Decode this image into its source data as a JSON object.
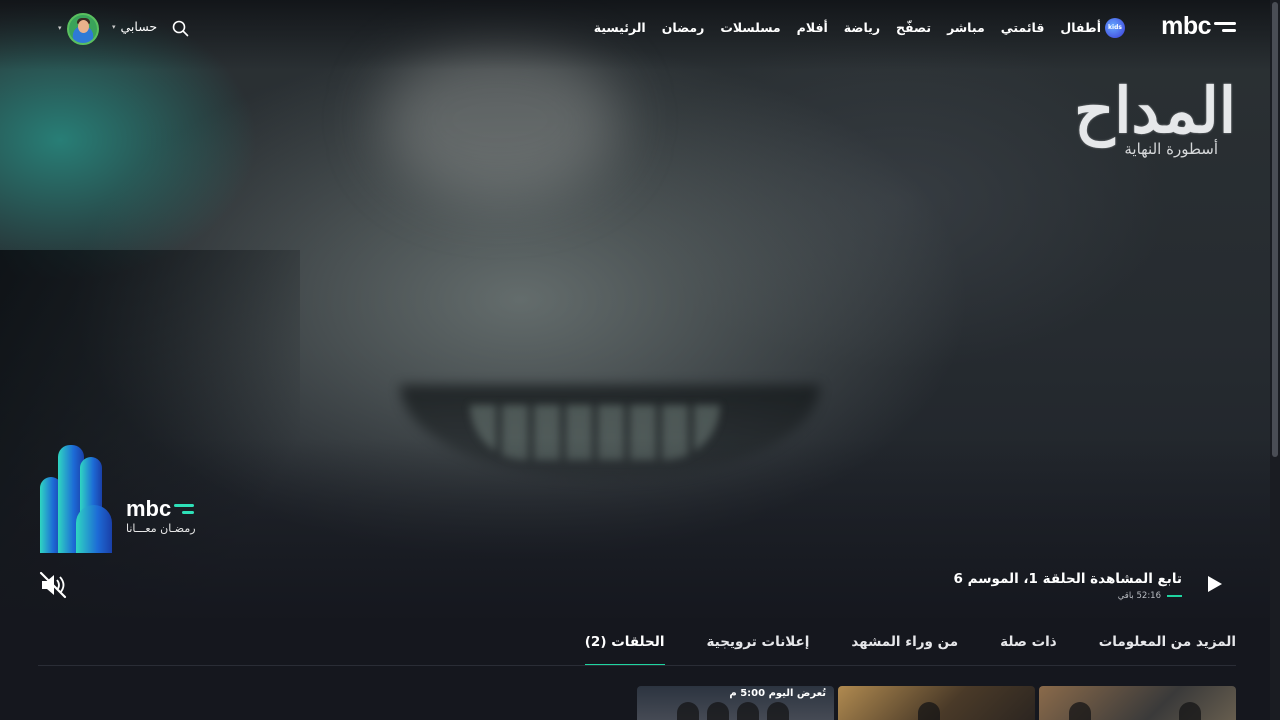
{
  "nav": {
    "logo": "mbc",
    "items": [
      "الرئيسية",
      "رمضان",
      "مسلسلات",
      "أفلام",
      "رياضة",
      "تصفّح",
      "مباشر",
      "قائمتي"
    ],
    "kids_label": "أطفال",
    "kids_badge": "kids",
    "account_label": "حسابي"
  },
  "show": {
    "title": "المداح",
    "subtitle": "أسطورة النهاية"
  },
  "ramadan_badge": {
    "brand": "mbc",
    "tagline": "رمضـان معـــانا"
  },
  "continue_watching": {
    "title": "تابع المشاهدة الحلقة 1، الموسم 6",
    "remaining": "52:16 باقي",
    "progress_fraction": 0.02
  },
  "tabs": [
    "الحلقات (2)",
    "إعلانات ترويجية",
    "من وراء المشهد",
    "ذات صلة",
    "المزيد من المعلومات"
  ],
  "episodes": {
    "airing_label": "تُعرض اليوم 5:00 م"
  },
  "colors": {
    "accent": "#1fd4a0",
    "background": "#15171e"
  },
  "icons": [
    "search-icon",
    "chevron-down-icon",
    "mute-icon",
    "play-icon"
  ]
}
